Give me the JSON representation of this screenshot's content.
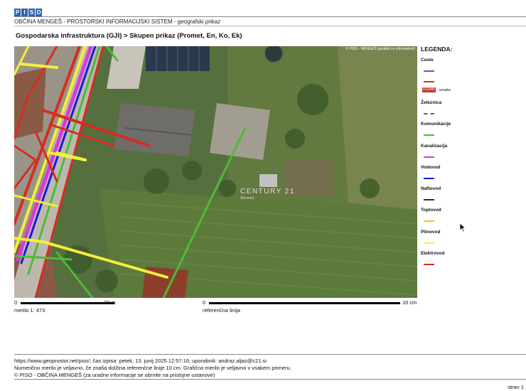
{
  "header": {
    "logo_letters": [
      "P",
      "I",
      "S",
      "O"
    ],
    "app_title": "OBČINA MENGEŠ - PROSTORSKI INFORMACIJSKI SISTEM - geografski prikaz"
  },
  "view_title": "Gospodarska infrastruktura (GJI) > Skupen prikaz (Promet, En, Ko, Ek)",
  "map": {
    "credit": "© PISO - MENGEŠ (podatki so informativni)",
    "watermark_main": "CENTURY 21",
    "watermark_sub": "Slovenia"
  },
  "legend": {
    "title": "LEGENDA:",
    "oznaka_box": "012345",
    "oznaka_label": "oznaka",
    "groups": [
      {
        "label": "Ceste",
        "swatches": [
          {
            "color": "#8e44ad",
            "style": "solid"
          },
          {
            "color": "#d62d20",
            "style": "solid"
          }
        ]
      },
      {
        "label": "Železnica",
        "swatches": [
          {
            "color": "#8e44ad",
            "style": "dash"
          }
        ]
      },
      {
        "label": "Komunikacije",
        "swatches": [
          {
            "color": "#4cbb3a",
            "style": "solid"
          }
        ]
      },
      {
        "label": "Kanalizacija",
        "swatches": [
          {
            "color": "#d63cd6",
            "style": "solid"
          }
        ]
      },
      {
        "label": "Vodovod",
        "swatches": [
          {
            "color": "#1a1adb",
            "style": "solid"
          }
        ]
      },
      {
        "label": "Naftovod",
        "swatches": [
          {
            "color": "#0d3b2e",
            "style": "solid"
          }
        ]
      },
      {
        "label": "Toplovod",
        "swatches": [
          {
            "color": "#e8c81a",
            "style": "solid"
          }
        ]
      },
      {
        "label": "Plinovod",
        "swatches": [
          {
            "color": "#f4ef3a",
            "style": "solid"
          }
        ]
      },
      {
        "label": "Elektrovod",
        "swatches": [
          {
            "color": "#d62d20",
            "style": "solid"
          }
        ]
      }
    ]
  },
  "scale": {
    "map_zero": "0",
    "map_end": "20 m",
    "map_caption": "merilo 1: 473",
    "ref_zero": "0",
    "ref_end": "10 cm",
    "ref_caption": "referenčna linija"
  },
  "footer": {
    "line1": "https://www.geoprostor.net/piso/; čas izpisa: petek, 13. junij 2025 12:57:16; uporabnik: andraz.aljaz@c21.si",
    "line2": "Numerično merilo je veljavno, če znaša dolžina referenčne linije 10 cm. Grafično merilo je veljavno v vsakem primeru.",
    "line3": "© PISO - OBČINA MENGEŠ (za uradne informacije se obrnite na pristojne ustanove)",
    "page": "stran 1"
  }
}
